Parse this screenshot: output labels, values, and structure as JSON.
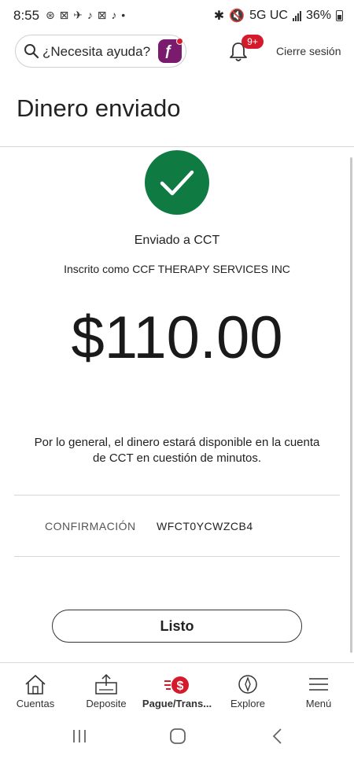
{
  "status_bar": {
    "time": "8:55",
    "left_icons": "⊛ ⊠ ✈ ♪ ⊠ ♪ •",
    "network": "5G UC",
    "battery": "36%"
  },
  "header": {
    "search_placeholder": "¿Necesita ayuda?",
    "notifications_badge": "9+",
    "signout_label": "Cierre sesión"
  },
  "page": {
    "title": "Dinero enviado"
  },
  "confirmation": {
    "sent_to": "Enviado a CCT",
    "registered_as": "Inscrito como CCF THERAPY SERVICES INC",
    "amount": "$110.00",
    "availability_line1": "Por lo general, el dinero estará disponible en la cuenta",
    "availability_line2": "de CCT en cuestión de minutos.",
    "confirmation_label": "CONFIRMACIÓN",
    "confirmation_value": "WFCT0YCWZCB4",
    "done_button": "Listo"
  },
  "bottom_nav": {
    "items": [
      {
        "label": "Cuentas",
        "icon": "home-icon"
      },
      {
        "label": "Deposite",
        "icon": "deposit-icon"
      },
      {
        "label": "Pague/Trans...",
        "icon": "pay-transfer-icon",
        "active": true
      },
      {
        "label": "Explore",
        "icon": "compass-icon"
      },
      {
        "label": "Menú",
        "icon": "menu-icon"
      }
    ]
  },
  "colors": {
    "success_green": "#0f7b43",
    "brand_red": "#d41b2c",
    "assistant_purple": "#7b1b6e"
  }
}
